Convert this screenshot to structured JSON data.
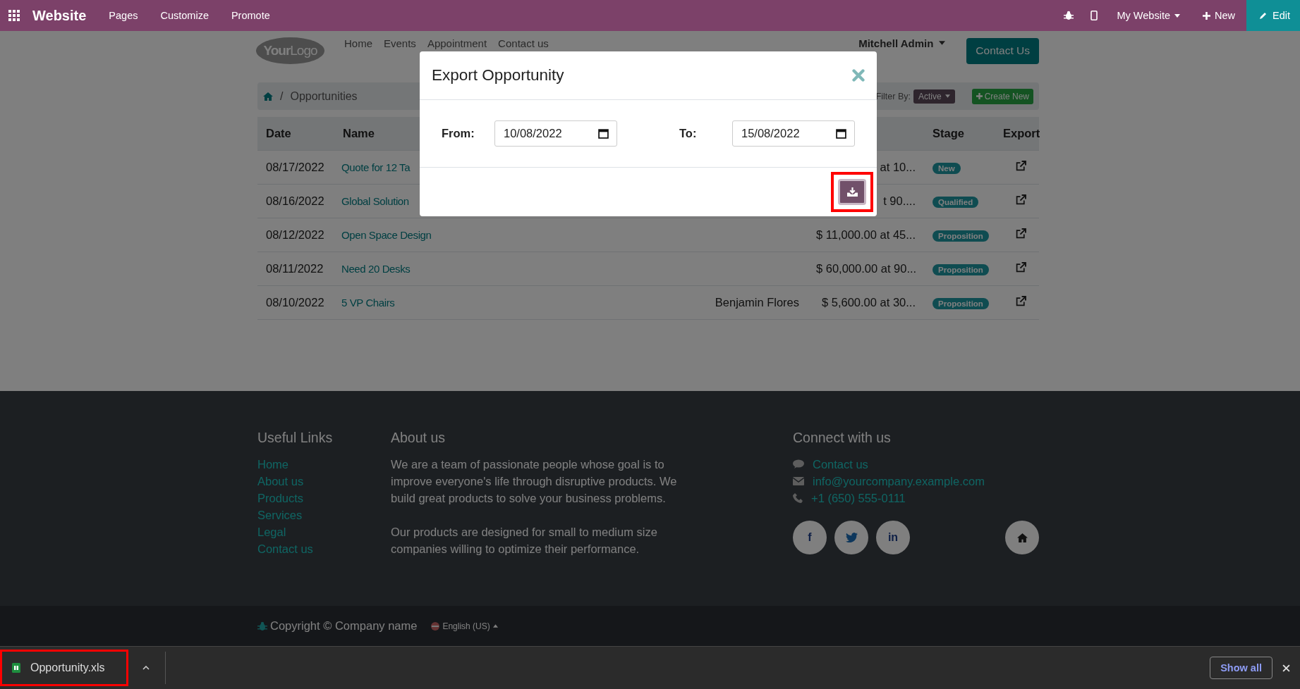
{
  "admin_bar": {
    "app": "Website",
    "menus": [
      "Pages",
      "Customize",
      "Promote"
    ],
    "site": "My Website",
    "new": "New",
    "edit": "Edit"
  },
  "header": {
    "logo": "**Your**Logo",
    "nav": [
      "Home",
      "Events",
      "Appointment",
      "Contact us"
    ],
    "user": "Mitchell Admin",
    "cta": "Contact Us"
  },
  "breadcrumb": {
    "separator": "/",
    "page": "Opportunities"
  },
  "filter": {
    "label": "Filter By:",
    "value": "Active",
    "create": "Create New"
  },
  "table": {
    "columns": [
      "Date",
      "Name",
      "Stage",
      "Export"
    ],
    "rows": [
      {
        "date": "08/17/2022",
        "name": "Quote for 12 Ta",
        "column_3": "",
        "column_4": "at 10...",
        "stage": "New"
      },
      {
        "date": "08/16/2022",
        "name": "Global Solution",
        "column_3": "",
        "column_4": "t 90....",
        "stage": "Qualified"
      },
      {
        "date": "08/12/2022",
        "name": "Open Space Design",
        "column_3": "",
        "column_4": "$ 11,000.00 at 45...",
        "stage": "Proposition"
      },
      {
        "date": "08/11/2022",
        "name": "Need 20 Desks",
        "column_3": "",
        "column_4": "$ 60,000.00 at 90...",
        "stage": "Proposition"
      },
      {
        "date": "08/10/2022",
        "name": "5 VP Chairs",
        "column_3": "Benjamin Flores",
        "column_4": "$ 5,600.00 at 30...",
        "stage": "Proposition"
      }
    ]
  },
  "modal": {
    "title": "Export Opportunity",
    "from_label": "From:",
    "from_value": "10/08/2022",
    "to_label": "To:",
    "to_value": "15/08/2022"
  },
  "footer": {
    "links_title": "Useful Links",
    "links": [
      "Home",
      "About us",
      "Products",
      "Services",
      "Legal",
      "Contact us"
    ],
    "about_title": "About us",
    "about": [
      "We are a team of passionate people whose goal is to improve everyone's life through disruptive products. We build great products to solve your business problems.",
      "Our products are designed for small to medium size companies willing to optimize their performance."
    ],
    "connect_title": "Connect with us",
    "contacts": [
      {
        "kind": "chat",
        "text": "Contact us"
      },
      {
        "kind": "mail",
        "text": "info@yourcompany.example.com"
      },
      {
        "kind": "phone",
        "text": "+1 (650) 555-0111"
      }
    ],
    "socials": [
      {
        "kind": "facebook",
        "label": "f"
      },
      {
        "kind": "twitter"
      },
      {
        "kind": "linkedin",
        "label": "in"
      },
      {
        "kind": "home"
      }
    ],
    "copyright": "Copyright © Company name",
    "language": "English (US)"
  },
  "download_bar": {
    "file": "Opportunity.xls",
    "show_all": "Show all"
  }
}
